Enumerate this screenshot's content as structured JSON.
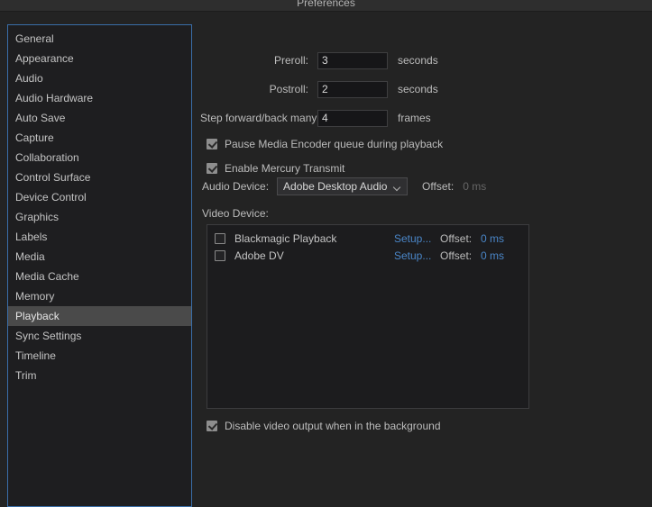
{
  "window": {
    "title": "Preferences"
  },
  "sidebar": {
    "items": [
      {
        "label": "General",
        "selected": false
      },
      {
        "label": "Appearance",
        "selected": false
      },
      {
        "label": "Audio",
        "selected": false
      },
      {
        "label": "Audio Hardware",
        "selected": false
      },
      {
        "label": "Auto Save",
        "selected": false
      },
      {
        "label": "Capture",
        "selected": false
      },
      {
        "label": "Collaboration",
        "selected": false
      },
      {
        "label": "Control Surface",
        "selected": false
      },
      {
        "label": "Device Control",
        "selected": false
      },
      {
        "label": "Graphics",
        "selected": false
      },
      {
        "label": "Labels",
        "selected": false
      },
      {
        "label": "Media",
        "selected": false
      },
      {
        "label": "Media Cache",
        "selected": false
      },
      {
        "label": "Memory",
        "selected": false
      },
      {
        "label": "Playback",
        "selected": true
      },
      {
        "label": "Sync Settings",
        "selected": false
      },
      {
        "label": "Timeline",
        "selected": false
      },
      {
        "label": "Trim",
        "selected": false
      }
    ]
  },
  "playback": {
    "preroll": {
      "label": "Preroll:",
      "value": "3",
      "unit": "seconds"
    },
    "postroll": {
      "label": "Postroll:",
      "value": "2",
      "unit": "seconds"
    },
    "step": {
      "label": "Step forward/back many:",
      "value": "4",
      "unit": "frames"
    },
    "pause_encoder": {
      "label": "Pause Media Encoder queue during playback",
      "checked": true
    },
    "mercury_transmit": {
      "label": "Enable Mercury Transmit",
      "checked": true
    },
    "audio_device": {
      "label": "Audio Device:",
      "value": "Adobe Desktop Audio",
      "offset_label": "Offset:",
      "offset_value": "0 ms",
      "chevron_icon": "chevron-down-icon"
    },
    "video_device": {
      "label": "Video Device:",
      "rows": [
        {
          "name": "Blackmagic Playback",
          "checked": false,
          "setup": "Setup...",
          "offset_label": "Offset:",
          "offset_value": "0 ms"
        },
        {
          "name": "Adobe DV",
          "checked": false,
          "setup": "Setup...",
          "offset_label": "Offset:",
          "offset_value": "0 ms"
        }
      ]
    },
    "disable_video_output": {
      "label": "Disable video output when in the background",
      "checked": true
    }
  },
  "colors": {
    "background": "#232323",
    "titlebar": "#2e2e2e",
    "focus_border": "#3a6ea8",
    "selection": "#4a4a4a",
    "link": "#4a86c8",
    "text": "#c4c4c4",
    "text_dim": "#666666"
  }
}
